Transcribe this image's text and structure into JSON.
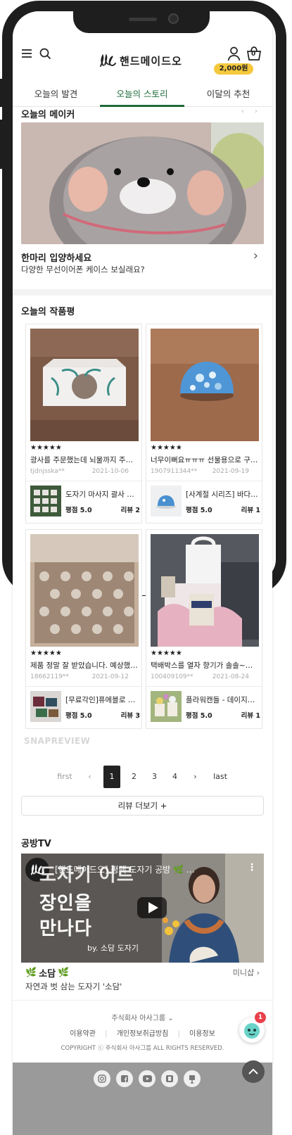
{
  "header": {
    "logo_text": "핸드메이드오",
    "points_badge": "2,000원",
    "cart_count": "0"
  },
  "tabs": [
    {
      "label": "오늘의 발견"
    },
    {
      "label": "오늘의 스토리"
    },
    {
      "label": "이달의 추천"
    }
  ],
  "maker": {
    "section_title": "오늘의 메이커",
    "title": "한마리 입양하세요",
    "subtitle": "다양한 무선이어폰 케이스 보실래요?"
  },
  "reviews": {
    "section_title": "오늘의 작품평",
    "items": [
      {
        "stars": "★★★★★",
        "text": "광사를 주문했는데 뇌물까지 주시…",
        "user": "tjdnjsska**",
        "date": "2021-10-06",
        "product": "도자기 마사지 괄사 …",
        "rating": "평점 5.0",
        "reviews": "리뷰 2"
      },
      {
        "stars": "★★★★★",
        "text": "너무이뻐요ㅠㅠㅠ 선물용으로 구…",
        "user": "1907911344**",
        "date": "2021-09-19",
        "product": "[사계절 시리즈] 바다…",
        "rating": "평점 5.0",
        "reviews": "리뷰 1"
      },
      {
        "stars": "★★★★★",
        "text": "제품 정말 잘 받았습니다. 예상했…",
        "user": "18662119**",
        "date": "2021-09-12",
        "product": "[무료각인]퓨에블로 …",
        "rating": "평점 5.0",
        "reviews": "리뷰 3"
      },
      {
        "stars": "★★★★★",
        "text": "택배박스를 열자 향기가 솔솔~~~ …",
        "user": "100409109**",
        "date": "2021-08-24",
        "product": "플라워캔들 - 데이지…",
        "rating": "평점 5.0",
        "reviews": "리뷰 1"
      }
    ],
    "snap_label": "SNAPREVIEW"
  },
  "pagination": {
    "first": "first",
    "prev": "‹",
    "pages": [
      "1",
      "2",
      "3",
      "4"
    ],
    "next": "›",
    "last": "last"
  },
  "more_button": "리뷰 더보기 +",
  "tv": {
    "section_title": "공방TV",
    "video_title": "[핸드메이드오] 평택 도자기 공방 🌿 …",
    "overlay_line1": "도자기 어르",
    "overlay_line2": "장인을",
    "overlay_line3": "만나다",
    "overlay_by": "by. 소담 도자기",
    "caption_title": "소담",
    "caption_sub": "자연과 벗 삼는 도자기 '소담'",
    "mini_link": "미니샵 ›"
  },
  "footer": {
    "company": "주식회사 아사그룹 ⌄",
    "links": [
      "이용약관",
      "개인정보취급방침",
      "이용정보"
    ],
    "copyright": "COPYRIGHT ⓒ 주식회사 아사그룹 ALL RIGHTS RESERVED."
  },
  "chat_badge": "1"
}
